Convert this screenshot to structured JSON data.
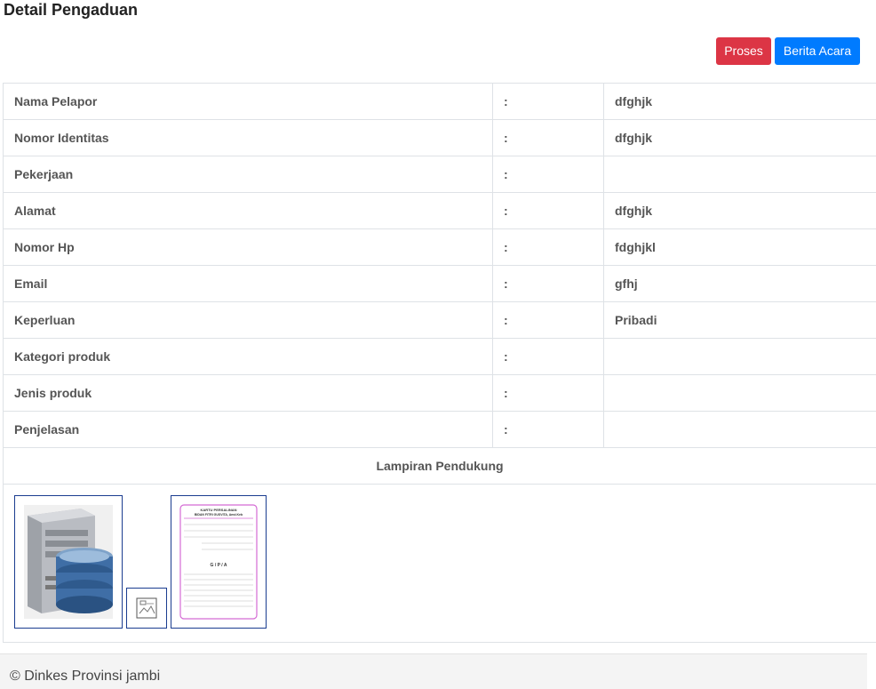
{
  "page": {
    "title": "Detail Pengaduan"
  },
  "toolbar": {
    "proses_label": "Proses",
    "berita_acara_label": "Berita Acara"
  },
  "details": [
    {
      "label": "Nama Pelapor",
      "colon": ":",
      "value": "dfghjk"
    },
    {
      "label": "Nomor Identitas",
      "colon": ":",
      "value": "dfghjk"
    },
    {
      "label": "Pekerjaan",
      "colon": ":",
      "value": ""
    },
    {
      "label": "Alamat",
      "colon": ":",
      "value": "dfghjk"
    },
    {
      "label": "Nomor Hp",
      "colon": ":",
      "value": "fdghjkl"
    },
    {
      "label": "Email",
      "colon": ":",
      "value": "gfhj"
    },
    {
      "label": "Keperluan",
      "colon": ":",
      "value": "Pribadi"
    },
    {
      "label": "Kategori produk",
      "colon": ":",
      "value": ""
    },
    {
      "label": "Jenis produk",
      "colon": ":",
      "value": ""
    },
    {
      "label": "Penjelasan",
      "colon": ":",
      "value": ""
    }
  ],
  "attachments": {
    "heading": "Lampiran Pendukung",
    "card": {
      "title": "KARTU PERSALINAN",
      "subtitle": "BIDAN FITRI GUSVITA, Amd.Keb",
      "gpa": "G / P / A"
    }
  },
  "footer": {
    "text": "© Dinkes Provinsi jambi"
  }
}
